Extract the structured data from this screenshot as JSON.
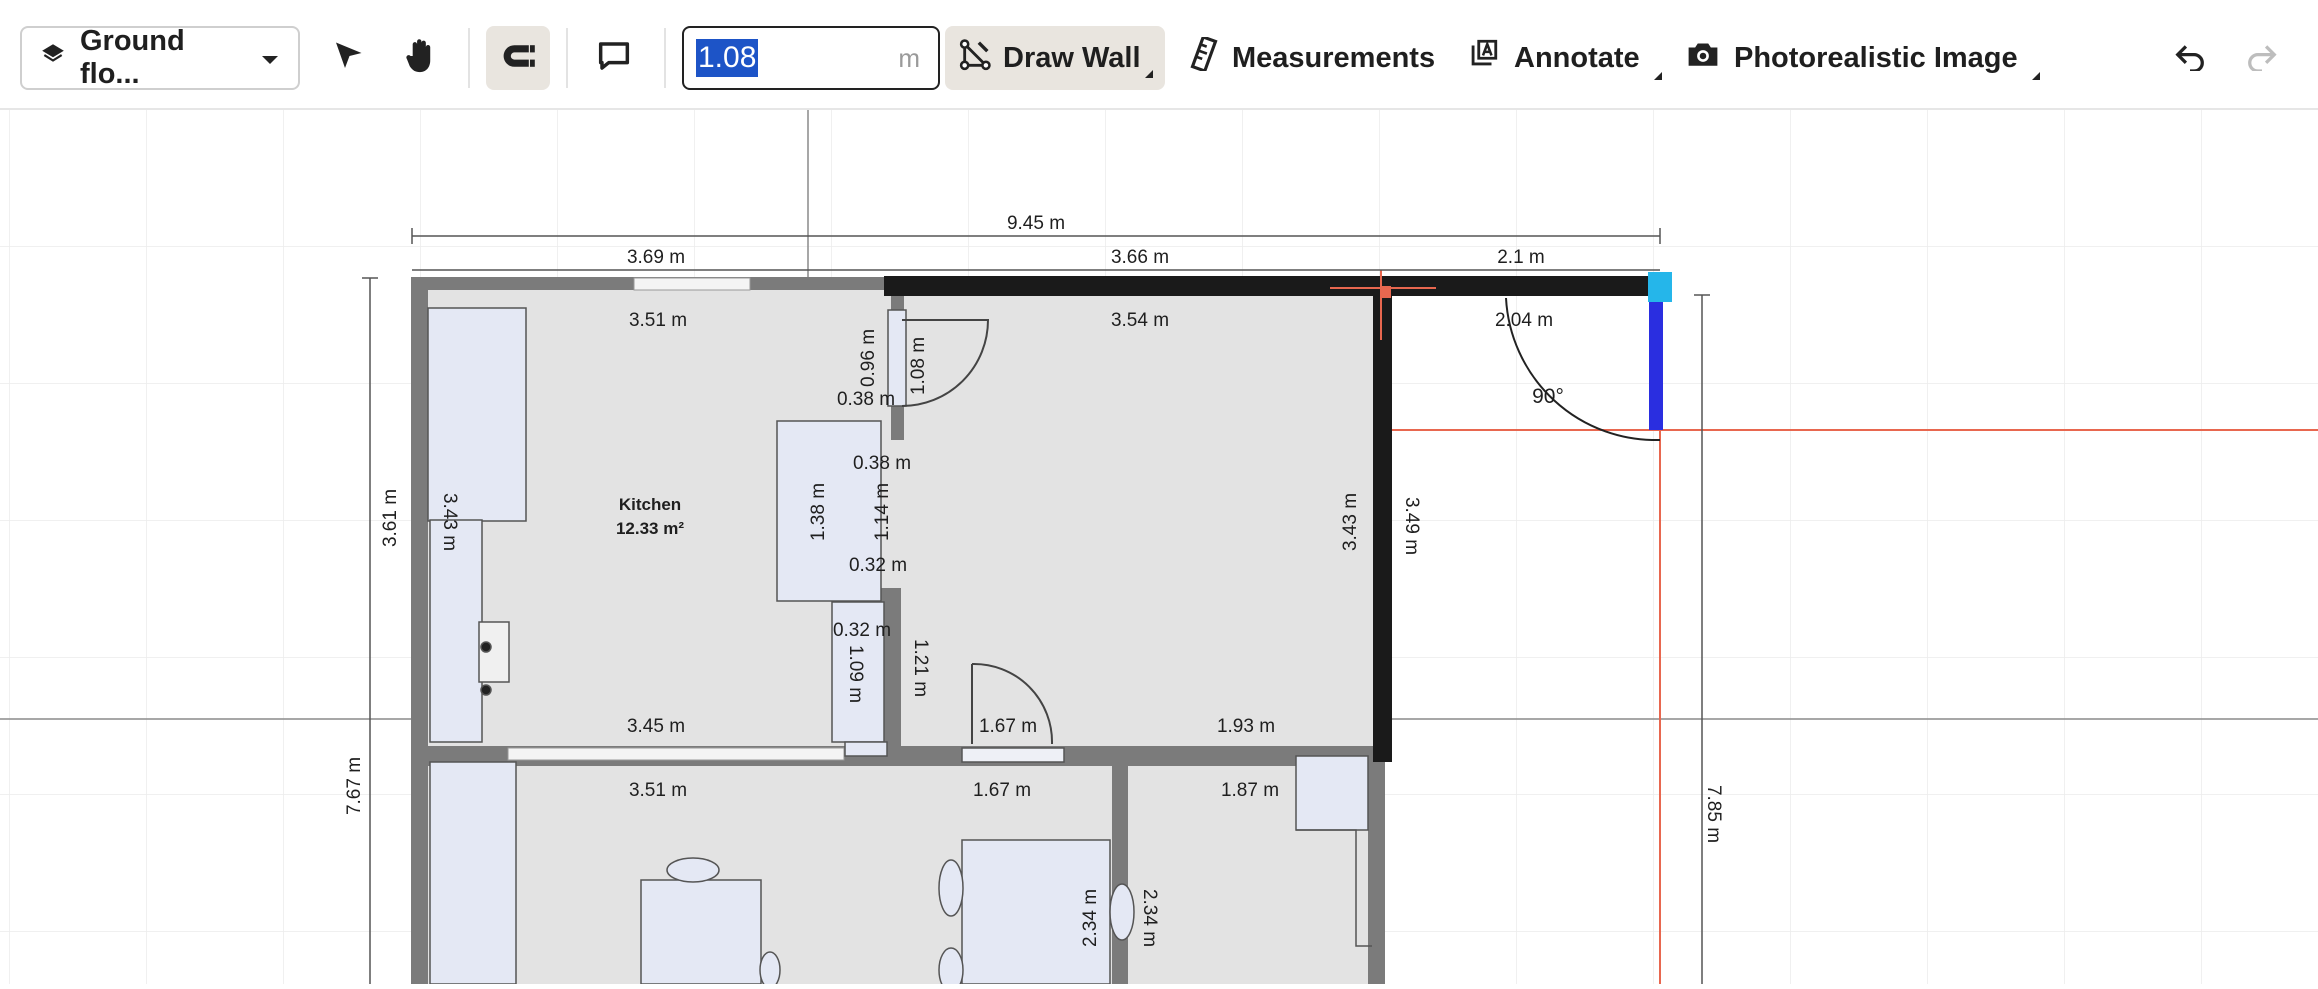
{
  "toolbar": {
    "floor_selector": "Ground flo...",
    "length_input": {
      "value": "1.08",
      "unit": "m"
    },
    "draw_wall": "Draw Wall",
    "measurements": "Measurements",
    "annotate": "Annotate",
    "photorealistic": "Photorealistic Image"
  },
  "plan": {
    "room": {
      "name": "Kitchen",
      "area": "12.33 m²"
    },
    "angle": "90°",
    "dims": {
      "overall_top": "9.45 m",
      "top_left": "3.69 m",
      "top_mid": "3.66 m",
      "top_right": "2.1 m",
      "in_top_left": "3.51 m",
      "in_top_mid": "3.54 m",
      "in_top_right": "2.04 m",
      "left_outer": "3.61 m",
      "left_inner": "3.43 m",
      "door_v1": "0.96 m",
      "door_v2": "1.08 m",
      "d038a": "0.38 m",
      "d038b": "0.38 m",
      "island_h": "1.38 m",
      "v114": "1.14 m",
      "d032a": "0.32 m",
      "d032b": "0.32 m",
      "v109": "1.09 m",
      "v121": "1.21 m",
      "right_inner": "3.43 m",
      "right_outer": "3.49 m",
      "bot_left": "3.45 m",
      "door_bot": "1.67 m",
      "bot_right": "1.93 m",
      "low_left": "3.51 m",
      "low_mid": "1.67 m",
      "low_right": "1.87 m",
      "left_total": "7.67 m",
      "right_total": "7.85 m",
      "v234a": "2.34 m",
      "v234b": "2.34 m"
    }
  },
  "colors": {
    "accent": "#1d54c7",
    "wall": "#1a1a1a",
    "wall_gray": "#7b7b7b",
    "guide": "#e8674f",
    "handle": "#25b6ea",
    "new_wall": "#2a2ee0"
  }
}
